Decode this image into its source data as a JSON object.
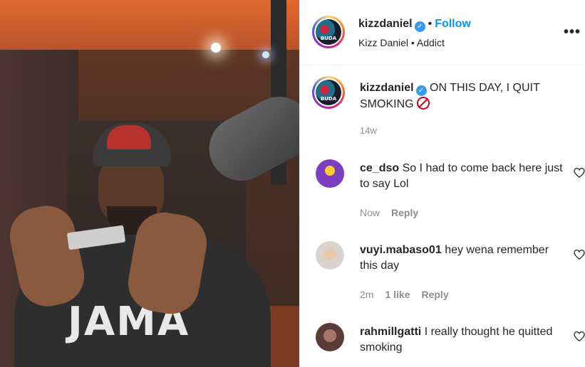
{
  "post": {
    "header": {
      "username": "kizzdaniel",
      "follow_label": "Follow",
      "subtitle": "Kizz Daniel • Addict",
      "more_label": "•••",
      "avatar_text": "BUDA"
    },
    "caption": {
      "username": "kizzdaniel",
      "text": "ON THIS DAY, I QUIT SMOKING",
      "emoji": "no-smoking-icon",
      "time": "14w"
    },
    "media": {
      "shirt_text": "JAMA"
    },
    "comments": [
      {
        "username": "ce_dso",
        "text": "So I had to come back here just to say Lol",
        "time": "Now",
        "likes": "",
        "reply_label": "Reply"
      },
      {
        "username": "vuyi.mabaso01",
        "text": "hey wena remember this day",
        "time": "2m",
        "likes": "1 like",
        "reply_label": "Reply"
      },
      {
        "username": "rahmillgatti",
        "text": "I really thought he quitted smoking",
        "time": "",
        "likes": "",
        "reply_label": ""
      }
    ]
  },
  "colors": {
    "link_blue": "#0095f6",
    "verified_blue": "#3897f0",
    "muted_text": "#8e8e8e"
  }
}
